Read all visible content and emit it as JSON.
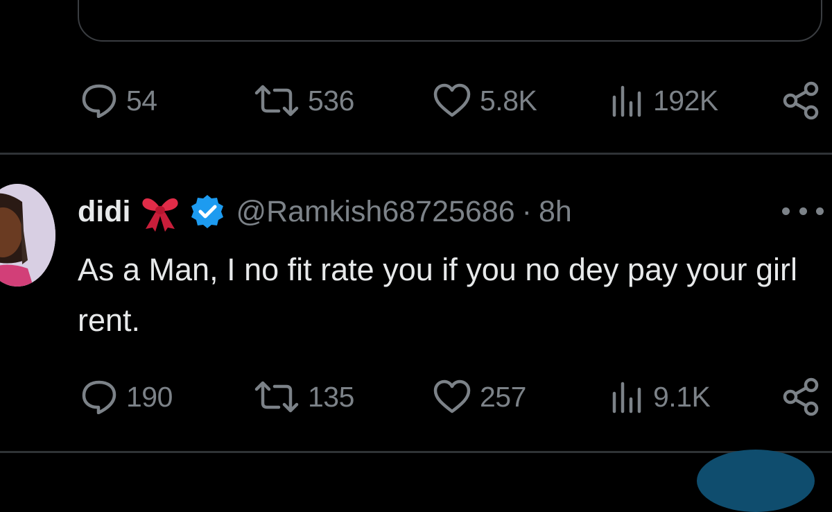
{
  "previous_tweet": {
    "actions": {
      "replies": "54",
      "reposts": "536",
      "likes": "5.8K",
      "views": "192K"
    }
  },
  "tweet": {
    "author": {
      "display_name": "didi",
      "name_emoji": "🎀",
      "verified": true,
      "handle": "@Ramkish68725686"
    },
    "separator": "·",
    "timestamp": "8h",
    "text": "As a Man, I no fit rate you if you no dey pay your girl rent.",
    "actions": {
      "replies": "190",
      "reposts": "135",
      "likes": "257",
      "views": "9.1K"
    }
  },
  "icons": {
    "reply": "reply-bubble-icon",
    "repost": "repost-arrows-icon",
    "like": "heart-icon",
    "views": "views-bars-icon",
    "share": "share-nodes-icon",
    "verified": "verified-badge-icon",
    "more": "more-dots-icon",
    "compose": "compose-fab"
  },
  "colors": {
    "background": "#000000",
    "text_primary": "#e7e9ea",
    "text_secondary": "#7c8288",
    "divider": "#2f3336",
    "verified_blue": "#1d9bf0",
    "ribbon_red": "#e02c48",
    "fab_blue": "#0f4d6e"
  }
}
